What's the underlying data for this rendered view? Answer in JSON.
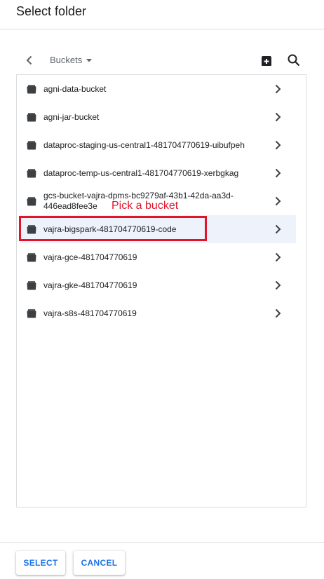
{
  "dialog": {
    "title": "Select folder"
  },
  "toolbar": {
    "breadcrumb": "Buckets",
    "icons": {
      "back": "arrow-back-icon",
      "caret": "caret-down-icon",
      "create_bucket": "create-bucket-icon",
      "search": "search-icon"
    }
  },
  "buckets": [
    {
      "name": "agni-data-bucket"
    },
    {
      "name": "agni-jar-bucket"
    },
    {
      "name": "dataproc-staging-us-central1-481704770619-uibufpeh"
    },
    {
      "name": "dataproc-temp-us-central1-481704770619-xerbgkag"
    },
    {
      "name": "gcs-bucket-vajra-dpms-bc9279af-43b1-42da-aa3d-446ead8fee3e"
    },
    {
      "name": "vajra-bigspark-481704770619-code",
      "selected": true
    },
    {
      "name": "vajra-gce-481704770619"
    },
    {
      "name": "vajra-gke-481704770619"
    },
    {
      "name": "vajra-s8s-481704770619"
    }
  ],
  "annotation": {
    "text": "Pick a bucket",
    "color": "#e0142b"
  },
  "footer": {
    "select_label": "SELECT",
    "cancel_label": "CANCEL"
  },
  "colors": {
    "accent": "#1a73e8",
    "selected_row": "#eef2fb",
    "text": "#202124",
    "secondary_text": "#5f6368"
  }
}
